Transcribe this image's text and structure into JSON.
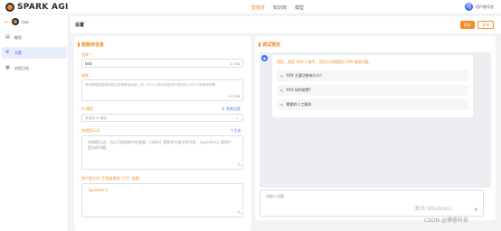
{
  "header": {
    "logo_text": "SPARK AGI",
    "nav": [
      "智能体",
      "知识库",
      "模型"
    ],
    "user_name": "用户账号名",
    "user_initial": "用"
  },
  "sidebar": {
    "back_icon": "arrow-left-icon",
    "app_name": "test",
    "items": [
      {
        "label": "概览",
        "icon": "overview-icon"
      },
      {
        "label": "设置",
        "icon": "gear-icon"
      },
      {
        "label": "对话日志",
        "icon": "log-icon"
      }
    ]
  },
  "subheader": {
    "title": "设置",
    "save_label": "保存",
    "publish_label": "发布"
  },
  "settings": {
    "section_title": "智能体信息",
    "name_label": "名称 *",
    "name_value": "test",
    "name_count": "4 / 64",
    "desc_label": "描述",
    "desc_placeholder": "请详细描述智能体的应用场景及用途，如：XXX 小助手回答用户提出的 XXX 产品使用问题",
    "desc_count": "0 / 256",
    "model_label": "AI 模型",
    "model_link": "参数设置",
    "model_placeholder": "请选择 AI 模型",
    "prompt_label": "系统提示词",
    "prompt_link": "生成",
    "prompt_placeholder": "系统提示词，可以引用系统中的变量：{data} 是参考文档中的引用；{question} 是用户提出的问题。",
    "user_prompt_label": "用户提示词 (引用变量用 {{}} 包裹)",
    "user_prompt_value": "{question}"
  },
  "preview": {
    "section_title": "调试预览",
    "greeting": "您好，我是 XXX 小助手，您可以向我提出 XXX 使用问题。",
    "suggestions": [
      "XXX 主要功能有什么？",
      "XXX 如何收费？",
      "需要转人工服务"
    ],
    "input_placeholder": "请输入问题"
  },
  "watermarks": {
    "activate": "激活 Windows",
    "csdn": "CSDN @博睿科技"
  },
  "colors": {
    "accent": "#f28c28",
    "primary": "#3b6cf0"
  }
}
